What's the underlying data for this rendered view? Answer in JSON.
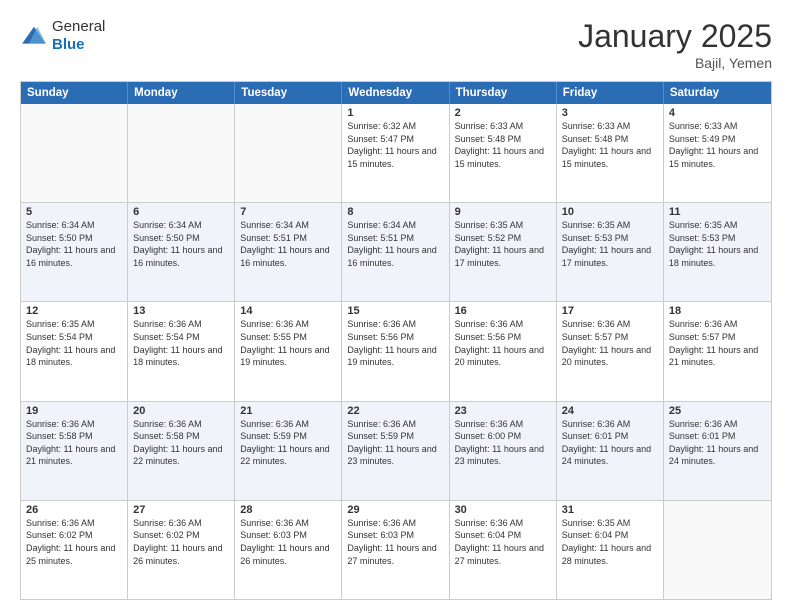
{
  "logo": {
    "general": "General",
    "blue": "Blue"
  },
  "title": {
    "month": "January 2025",
    "location": "Bajil, Yemen"
  },
  "header_days": [
    "Sunday",
    "Monday",
    "Tuesday",
    "Wednesday",
    "Thursday",
    "Friday",
    "Saturday"
  ],
  "weeks": [
    {
      "shade": false,
      "cells": [
        {
          "day": "",
          "info": ""
        },
        {
          "day": "",
          "info": ""
        },
        {
          "day": "",
          "info": ""
        },
        {
          "day": "1",
          "info": "Sunrise: 6:32 AM\nSunset: 5:47 PM\nDaylight: 11 hours and 15 minutes."
        },
        {
          "day": "2",
          "info": "Sunrise: 6:33 AM\nSunset: 5:48 PM\nDaylight: 11 hours and 15 minutes."
        },
        {
          "day": "3",
          "info": "Sunrise: 6:33 AM\nSunset: 5:48 PM\nDaylight: 11 hours and 15 minutes."
        },
        {
          "day": "4",
          "info": "Sunrise: 6:33 AM\nSunset: 5:49 PM\nDaylight: 11 hours and 15 minutes."
        }
      ]
    },
    {
      "shade": true,
      "cells": [
        {
          "day": "5",
          "info": "Sunrise: 6:34 AM\nSunset: 5:50 PM\nDaylight: 11 hours and 16 minutes."
        },
        {
          "day": "6",
          "info": "Sunrise: 6:34 AM\nSunset: 5:50 PM\nDaylight: 11 hours and 16 minutes."
        },
        {
          "day": "7",
          "info": "Sunrise: 6:34 AM\nSunset: 5:51 PM\nDaylight: 11 hours and 16 minutes."
        },
        {
          "day": "8",
          "info": "Sunrise: 6:34 AM\nSunset: 5:51 PM\nDaylight: 11 hours and 16 minutes."
        },
        {
          "day": "9",
          "info": "Sunrise: 6:35 AM\nSunset: 5:52 PM\nDaylight: 11 hours and 17 minutes."
        },
        {
          "day": "10",
          "info": "Sunrise: 6:35 AM\nSunset: 5:53 PM\nDaylight: 11 hours and 17 minutes."
        },
        {
          "day": "11",
          "info": "Sunrise: 6:35 AM\nSunset: 5:53 PM\nDaylight: 11 hours and 18 minutes."
        }
      ]
    },
    {
      "shade": false,
      "cells": [
        {
          "day": "12",
          "info": "Sunrise: 6:35 AM\nSunset: 5:54 PM\nDaylight: 11 hours and 18 minutes."
        },
        {
          "day": "13",
          "info": "Sunrise: 6:36 AM\nSunset: 5:54 PM\nDaylight: 11 hours and 18 minutes."
        },
        {
          "day": "14",
          "info": "Sunrise: 6:36 AM\nSunset: 5:55 PM\nDaylight: 11 hours and 19 minutes."
        },
        {
          "day": "15",
          "info": "Sunrise: 6:36 AM\nSunset: 5:56 PM\nDaylight: 11 hours and 19 minutes."
        },
        {
          "day": "16",
          "info": "Sunrise: 6:36 AM\nSunset: 5:56 PM\nDaylight: 11 hours and 20 minutes."
        },
        {
          "day": "17",
          "info": "Sunrise: 6:36 AM\nSunset: 5:57 PM\nDaylight: 11 hours and 20 minutes."
        },
        {
          "day": "18",
          "info": "Sunrise: 6:36 AM\nSunset: 5:57 PM\nDaylight: 11 hours and 21 minutes."
        }
      ]
    },
    {
      "shade": true,
      "cells": [
        {
          "day": "19",
          "info": "Sunrise: 6:36 AM\nSunset: 5:58 PM\nDaylight: 11 hours and 21 minutes."
        },
        {
          "day": "20",
          "info": "Sunrise: 6:36 AM\nSunset: 5:58 PM\nDaylight: 11 hours and 22 minutes."
        },
        {
          "day": "21",
          "info": "Sunrise: 6:36 AM\nSunset: 5:59 PM\nDaylight: 11 hours and 22 minutes."
        },
        {
          "day": "22",
          "info": "Sunrise: 6:36 AM\nSunset: 5:59 PM\nDaylight: 11 hours and 23 minutes."
        },
        {
          "day": "23",
          "info": "Sunrise: 6:36 AM\nSunset: 6:00 PM\nDaylight: 11 hours and 23 minutes."
        },
        {
          "day": "24",
          "info": "Sunrise: 6:36 AM\nSunset: 6:01 PM\nDaylight: 11 hours and 24 minutes."
        },
        {
          "day": "25",
          "info": "Sunrise: 6:36 AM\nSunset: 6:01 PM\nDaylight: 11 hours and 24 minutes."
        }
      ]
    },
    {
      "shade": false,
      "cells": [
        {
          "day": "26",
          "info": "Sunrise: 6:36 AM\nSunset: 6:02 PM\nDaylight: 11 hours and 25 minutes."
        },
        {
          "day": "27",
          "info": "Sunrise: 6:36 AM\nSunset: 6:02 PM\nDaylight: 11 hours and 26 minutes."
        },
        {
          "day": "28",
          "info": "Sunrise: 6:36 AM\nSunset: 6:03 PM\nDaylight: 11 hours and 26 minutes."
        },
        {
          "day": "29",
          "info": "Sunrise: 6:36 AM\nSunset: 6:03 PM\nDaylight: 11 hours and 27 minutes."
        },
        {
          "day": "30",
          "info": "Sunrise: 6:36 AM\nSunset: 6:04 PM\nDaylight: 11 hours and 27 minutes."
        },
        {
          "day": "31",
          "info": "Sunrise: 6:35 AM\nSunset: 6:04 PM\nDaylight: 11 hours and 28 minutes."
        },
        {
          "day": "",
          "info": ""
        }
      ]
    }
  ]
}
